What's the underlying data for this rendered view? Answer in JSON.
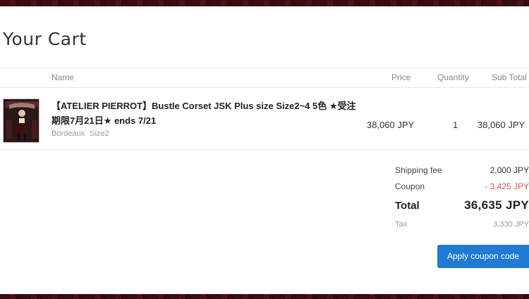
{
  "page": {
    "title": "Your Cart"
  },
  "table": {
    "headers": {
      "name": "Name",
      "price": "Price",
      "quantity": "Quantity",
      "subtotal": "Sub Total"
    },
    "items": [
      {
        "name": "【ATELIER PIERROT】Bustle Corset JSK Plus size Size2~4 5色 ★受注期限7月21日★ ends 7/21",
        "variant": "Bordeaux Size2",
        "price": "38,060 JPY",
        "quantity": "1",
        "subtotal": "38,060 JPY"
      }
    ]
  },
  "summary": {
    "shipping_label": "Shipping fee",
    "shipping_value": "2,000 JPY",
    "coupon_label": "Coupon",
    "coupon_value": "- 3,425 JPY",
    "total_label": "Total",
    "total_value": "36,635 JPY",
    "tax_label": "Tax",
    "tax_value": "3,330 JPY"
  },
  "actions": {
    "apply_coupon": "Apply coupon code"
  },
  "colors": {
    "accent": "#1f7ad4",
    "coupon": "#e05050",
    "frame": "#3f0d14"
  },
  "icons": {
    "thumbnail": "product-thumbnail-image"
  }
}
